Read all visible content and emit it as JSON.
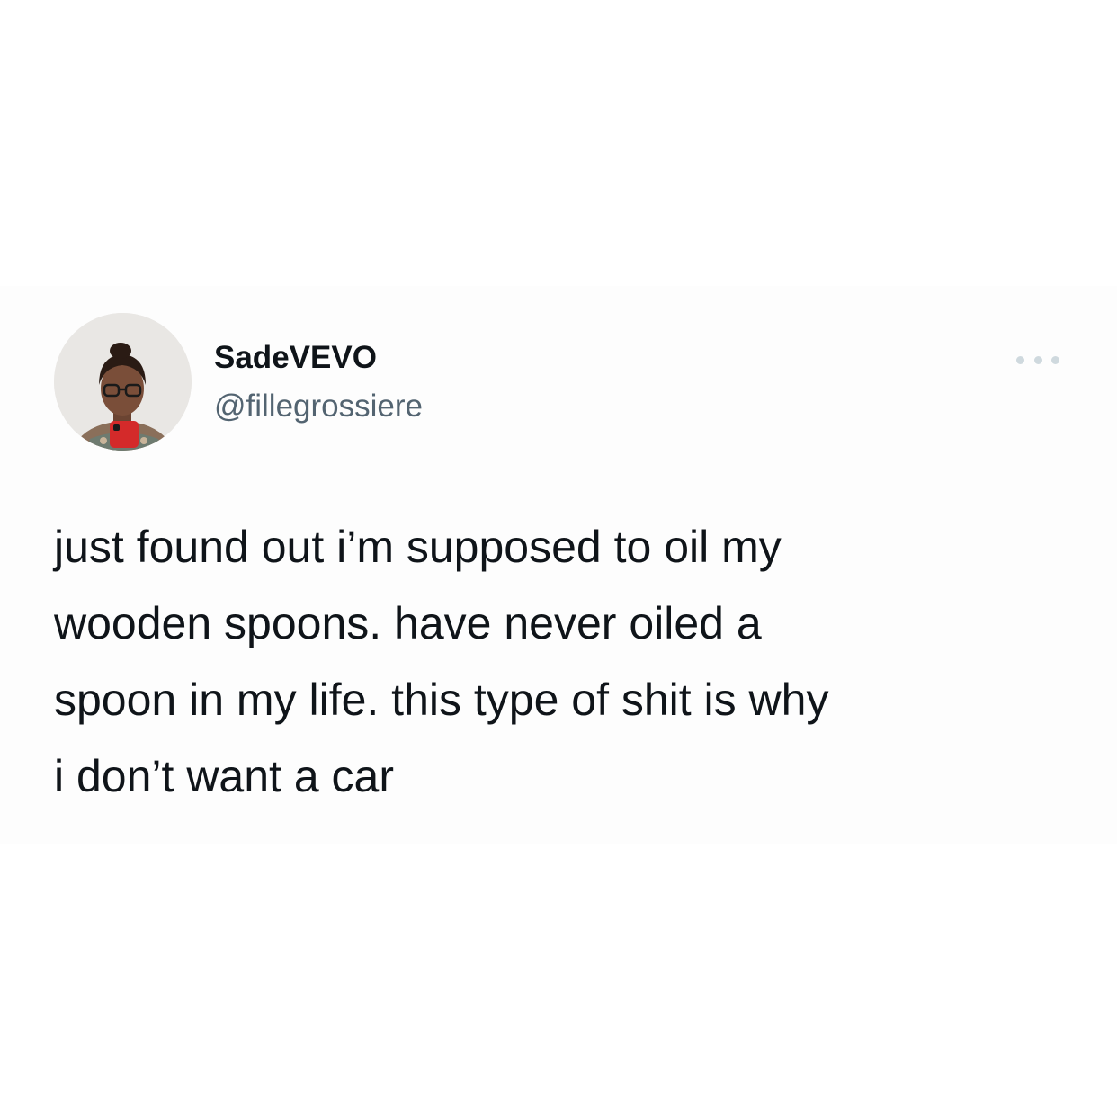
{
  "tweet": {
    "display_name": "SadeVEVO",
    "handle": "@fillegrossiere",
    "text": "just found out i’m supposed to oil my\nwooden spoons. have never oiled a\nspoon in my life. this type of shit is why\ni don’t want a car",
    "more_icon": "more-horizontal-icon"
  },
  "colors": {
    "name": "#0f1419",
    "handle": "#536471",
    "text": "#0f1419",
    "more_dots": "#cfd9de",
    "phone_case": "#d42a2a"
  }
}
